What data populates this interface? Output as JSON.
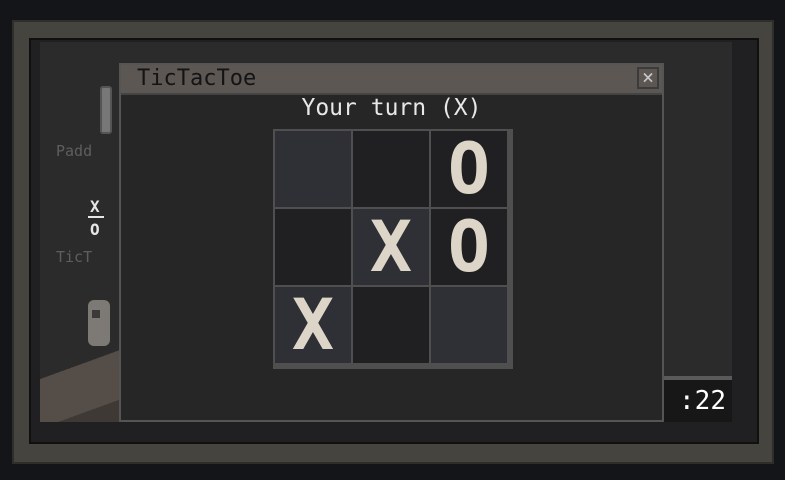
{
  "desktop": {
    "paddle_label": "Padd",
    "tictac_label": "TicT",
    "mini_x": "X",
    "mini_o": "O",
    "clock": ":22"
  },
  "window": {
    "title": "TicTacToe",
    "close": "×",
    "status": "Your turn (X)",
    "cells": [
      "",
      "",
      "O",
      "",
      "X",
      "O",
      "X",
      "",
      ""
    ]
  }
}
